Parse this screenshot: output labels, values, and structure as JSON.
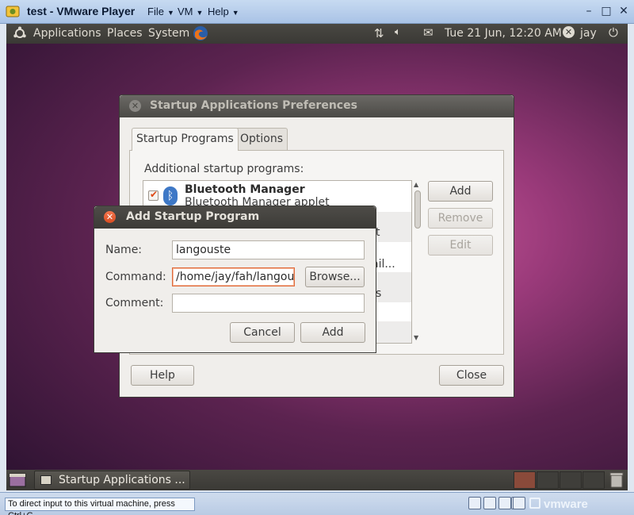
{
  "host": {
    "title": "test - VMware Player",
    "menus": [
      "File",
      "VM",
      "Help"
    ],
    "controls": [
      "–",
      "□",
      "✕"
    ]
  },
  "top_panel": {
    "menus": [
      "Applications",
      "Places",
      "System"
    ],
    "datetime": "Tue 21 Jun, 12:20 AM",
    "user": "jay"
  },
  "prefs_dialog": {
    "title": "Startup Applications Preferences",
    "tabs": [
      "Startup Programs",
      "Options"
    ],
    "list_label": "Additional startup programs:",
    "items": [
      {
        "name": "Bluetooth Manager",
        "description": "Bluetooth Manager applet",
        "checked": true
      }
    ],
    "partial_texts": [
      "t",
      "ail...",
      "s"
    ],
    "buttons": {
      "add": "Add",
      "remove": "Remove",
      "edit": "Edit",
      "help": "Help",
      "close": "Close"
    }
  },
  "add_dialog": {
    "title": "Add Startup Program",
    "name_label": "Name:",
    "name_value": "langouste",
    "command_label": "Command:",
    "command_value": "/home/jay/fah/langouste",
    "comment_label": "Comment:",
    "comment_value": "",
    "browse": "Browse...",
    "cancel": "Cancel",
    "add": "Add"
  },
  "taskbar": {
    "task": "Startup Applications ..."
  },
  "statusbar": {
    "hint": "To direct input to this virtual machine, press Ctrl+G.",
    "brand": "vmware"
  },
  "colors": {
    "ubuntu_orange": "#dd4814",
    "panel": "#3c3b37",
    "host_chrome": "#b9cbe4"
  }
}
